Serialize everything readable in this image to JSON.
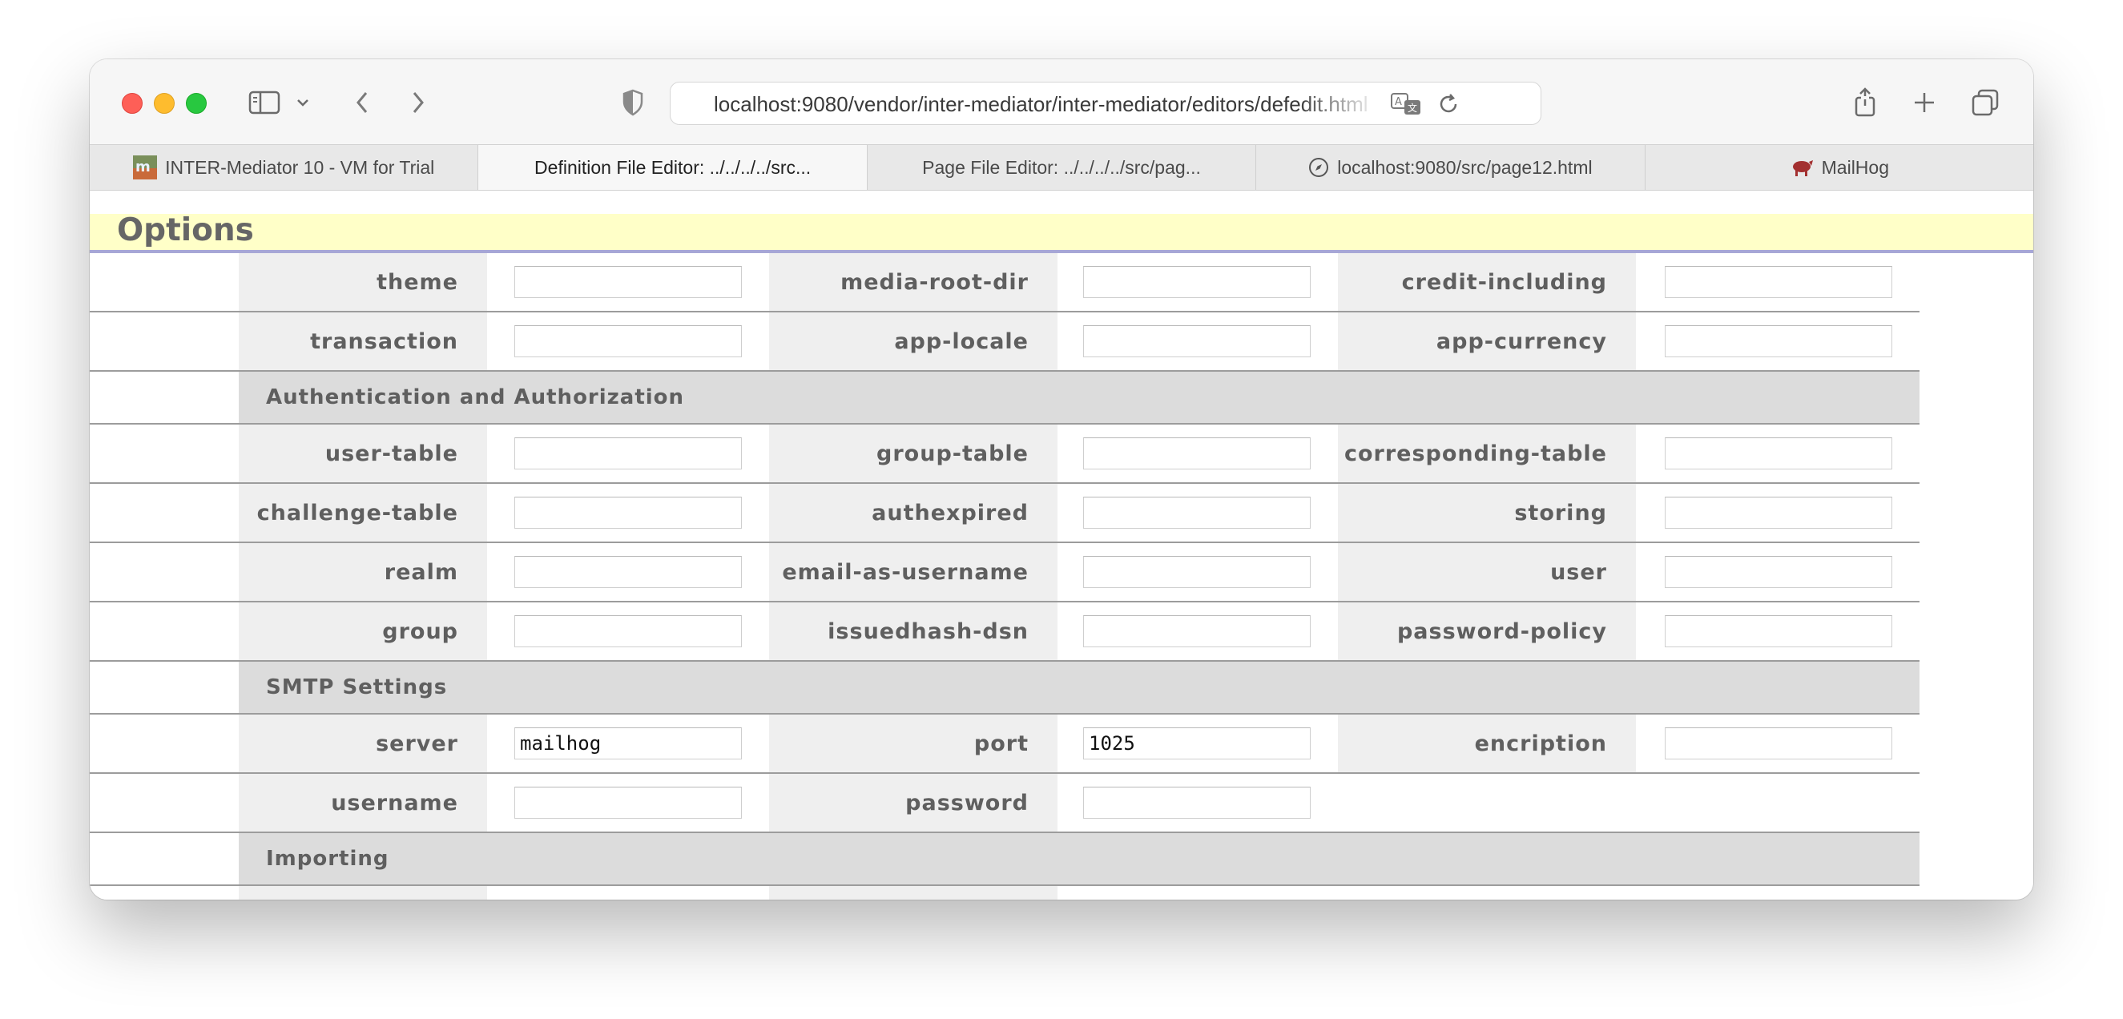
{
  "browser": {
    "url": "localhost:9080/vendor/inter-mediator/inter-mediator/editors/defedit.html",
    "tabs": [
      {
        "label": "INTER-Mediator 10 - VM for Trial",
        "active": false
      },
      {
        "label": "Definition File Editor: ../../../../src...",
        "active": true
      },
      {
        "label": "Page File Editor: ../../../../src/pag...",
        "active": false
      },
      {
        "label": "localhost:9080/src/page12.html",
        "active": false
      },
      {
        "label": "MailHog",
        "active": false
      }
    ]
  },
  "page": {
    "section_title": "Options",
    "rows_general": [
      {
        "l1": "theme",
        "v1": "",
        "l2": "media-root-dir",
        "v2": "",
        "l3": "credit-including",
        "v3": ""
      },
      {
        "l1": "transaction",
        "v1": "",
        "l2": "app-locale",
        "v2": "",
        "l3": "app-currency",
        "v3": ""
      }
    ],
    "auth_header": "Authentication and Authorization",
    "rows_auth": [
      {
        "l1": "user-table",
        "v1": "",
        "l2": "group-table",
        "v2": "",
        "l3": "corresponding-table",
        "v3": ""
      },
      {
        "l1": "challenge-table",
        "v1": "",
        "l2": "authexpired",
        "v2": "",
        "l3": "storing",
        "v3": ""
      },
      {
        "l1": "realm",
        "v1": "",
        "l2": "email-as-username",
        "v2": "",
        "l3": "user",
        "v3": ""
      },
      {
        "l1": "group",
        "v1": "",
        "l2": "issuedhash-dsn",
        "v2": "",
        "l3": "password-policy",
        "v3": ""
      }
    ],
    "smtp_header": "SMTP Settings",
    "rows_smtp": [
      {
        "l1": "server",
        "v1": "mailhog",
        "l2": "port",
        "v2": "1025",
        "l3": "encription",
        "v3": ""
      },
      {
        "l1": "username",
        "v1": "",
        "l2": "password",
        "v2": ""
      }
    ],
    "import_header": "Importing"
  },
  "colors": {
    "options_bg": "#ffffc8",
    "options_border": "#a7a7d6",
    "label_bg": "#efefef",
    "section_bg": "#dcdcdc",
    "label_text": "#5f5f5f"
  }
}
